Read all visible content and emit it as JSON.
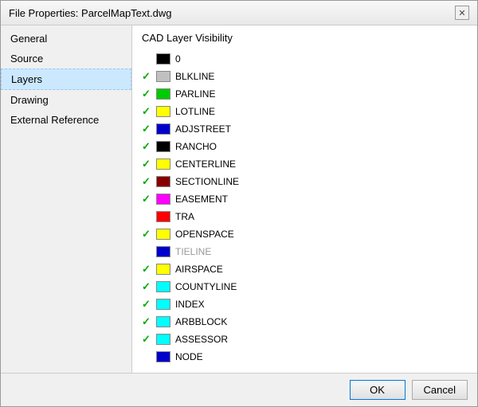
{
  "dialog": {
    "title": "File Properties: ParcelMapText.dwg",
    "close_label": "✕"
  },
  "sidebar": {
    "items": [
      {
        "id": "general",
        "label": "General",
        "active": false
      },
      {
        "id": "source",
        "label": "Source",
        "active": false
      },
      {
        "id": "layers",
        "label": "Layers",
        "active": true
      },
      {
        "id": "drawing",
        "label": "Drawing",
        "active": false
      },
      {
        "id": "external-reference",
        "label": "External Reference",
        "active": false
      }
    ]
  },
  "content": {
    "header": "CAD Layer Visibility",
    "layers": [
      {
        "checked": false,
        "color": "#000000",
        "name": "0",
        "disabled": false
      },
      {
        "checked": true,
        "color": "#c0c0c0",
        "name": "BLKLINE",
        "disabled": false
      },
      {
        "checked": true,
        "color": "#00cc00",
        "name": "PARLINE",
        "disabled": false
      },
      {
        "checked": true,
        "color": "#ffff00",
        "name": "LOTLINE",
        "disabled": false
      },
      {
        "checked": true,
        "color": "#0000cc",
        "name": "ADJSTREET",
        "disabled": false
      },
      {
        "checked": true,
        "color": "#000000",
        "name": "RANCHO",
        "disabled": false
      },
      {
        "checked": true,
        "color": "#ffff00",
        "name": "CENTERLINE",
        "disabled": false
      },
      {
        "checked": true,
        "color": "#880000",
        "name": "SECTIONLINE",
        "disabled": false
      },
      {
        "checked": true,
        "color": "#ff00ff",
        "name": "EASEMENT",
        "disabled": false
      },
      {
        "checked": false,
        "color": "#ff0000",
        "name": "TRA",
        "disabled": false
      },
      {
        "checked": true,
        "color": "#ffff00",
        "name": "OPENSPACE",
        "disabled": false
      },
      {
        "checked": false,
        "color": "#0000cc",
        "name": "TIELINE",
        "disabled": true
      },
      {
        "checked": true,
        "color": "#ffff00",
        "name": "AIRSPACE",
        "disabled": false
      },
      {
        "checked": true,
        "color": "#00ffff",
        "name": "COUNTYLINE",
        "disabled": false
      },
      {
        "checked": true,
        "color": "#00ffff",
        "name": "INDEX",
        "disabled": false
      },
      {
        "checked": true,
        "color": "#00ffff",
        "name": "ARBBLOCK",
        "disabled": false
      },
      {
        "checked": true,
        "color": "#00ffff",
        "name": "ASSESSOR",
        "disabled": false
      },
      {
        "checked": false,
        "color": "#0000cc",
        "name": "NODE",
        "disabled": false
      }
    ]
  },
  "footer": {
    "ok_label": "OK",
    "cancel_label": "Cancel"
  }
}
